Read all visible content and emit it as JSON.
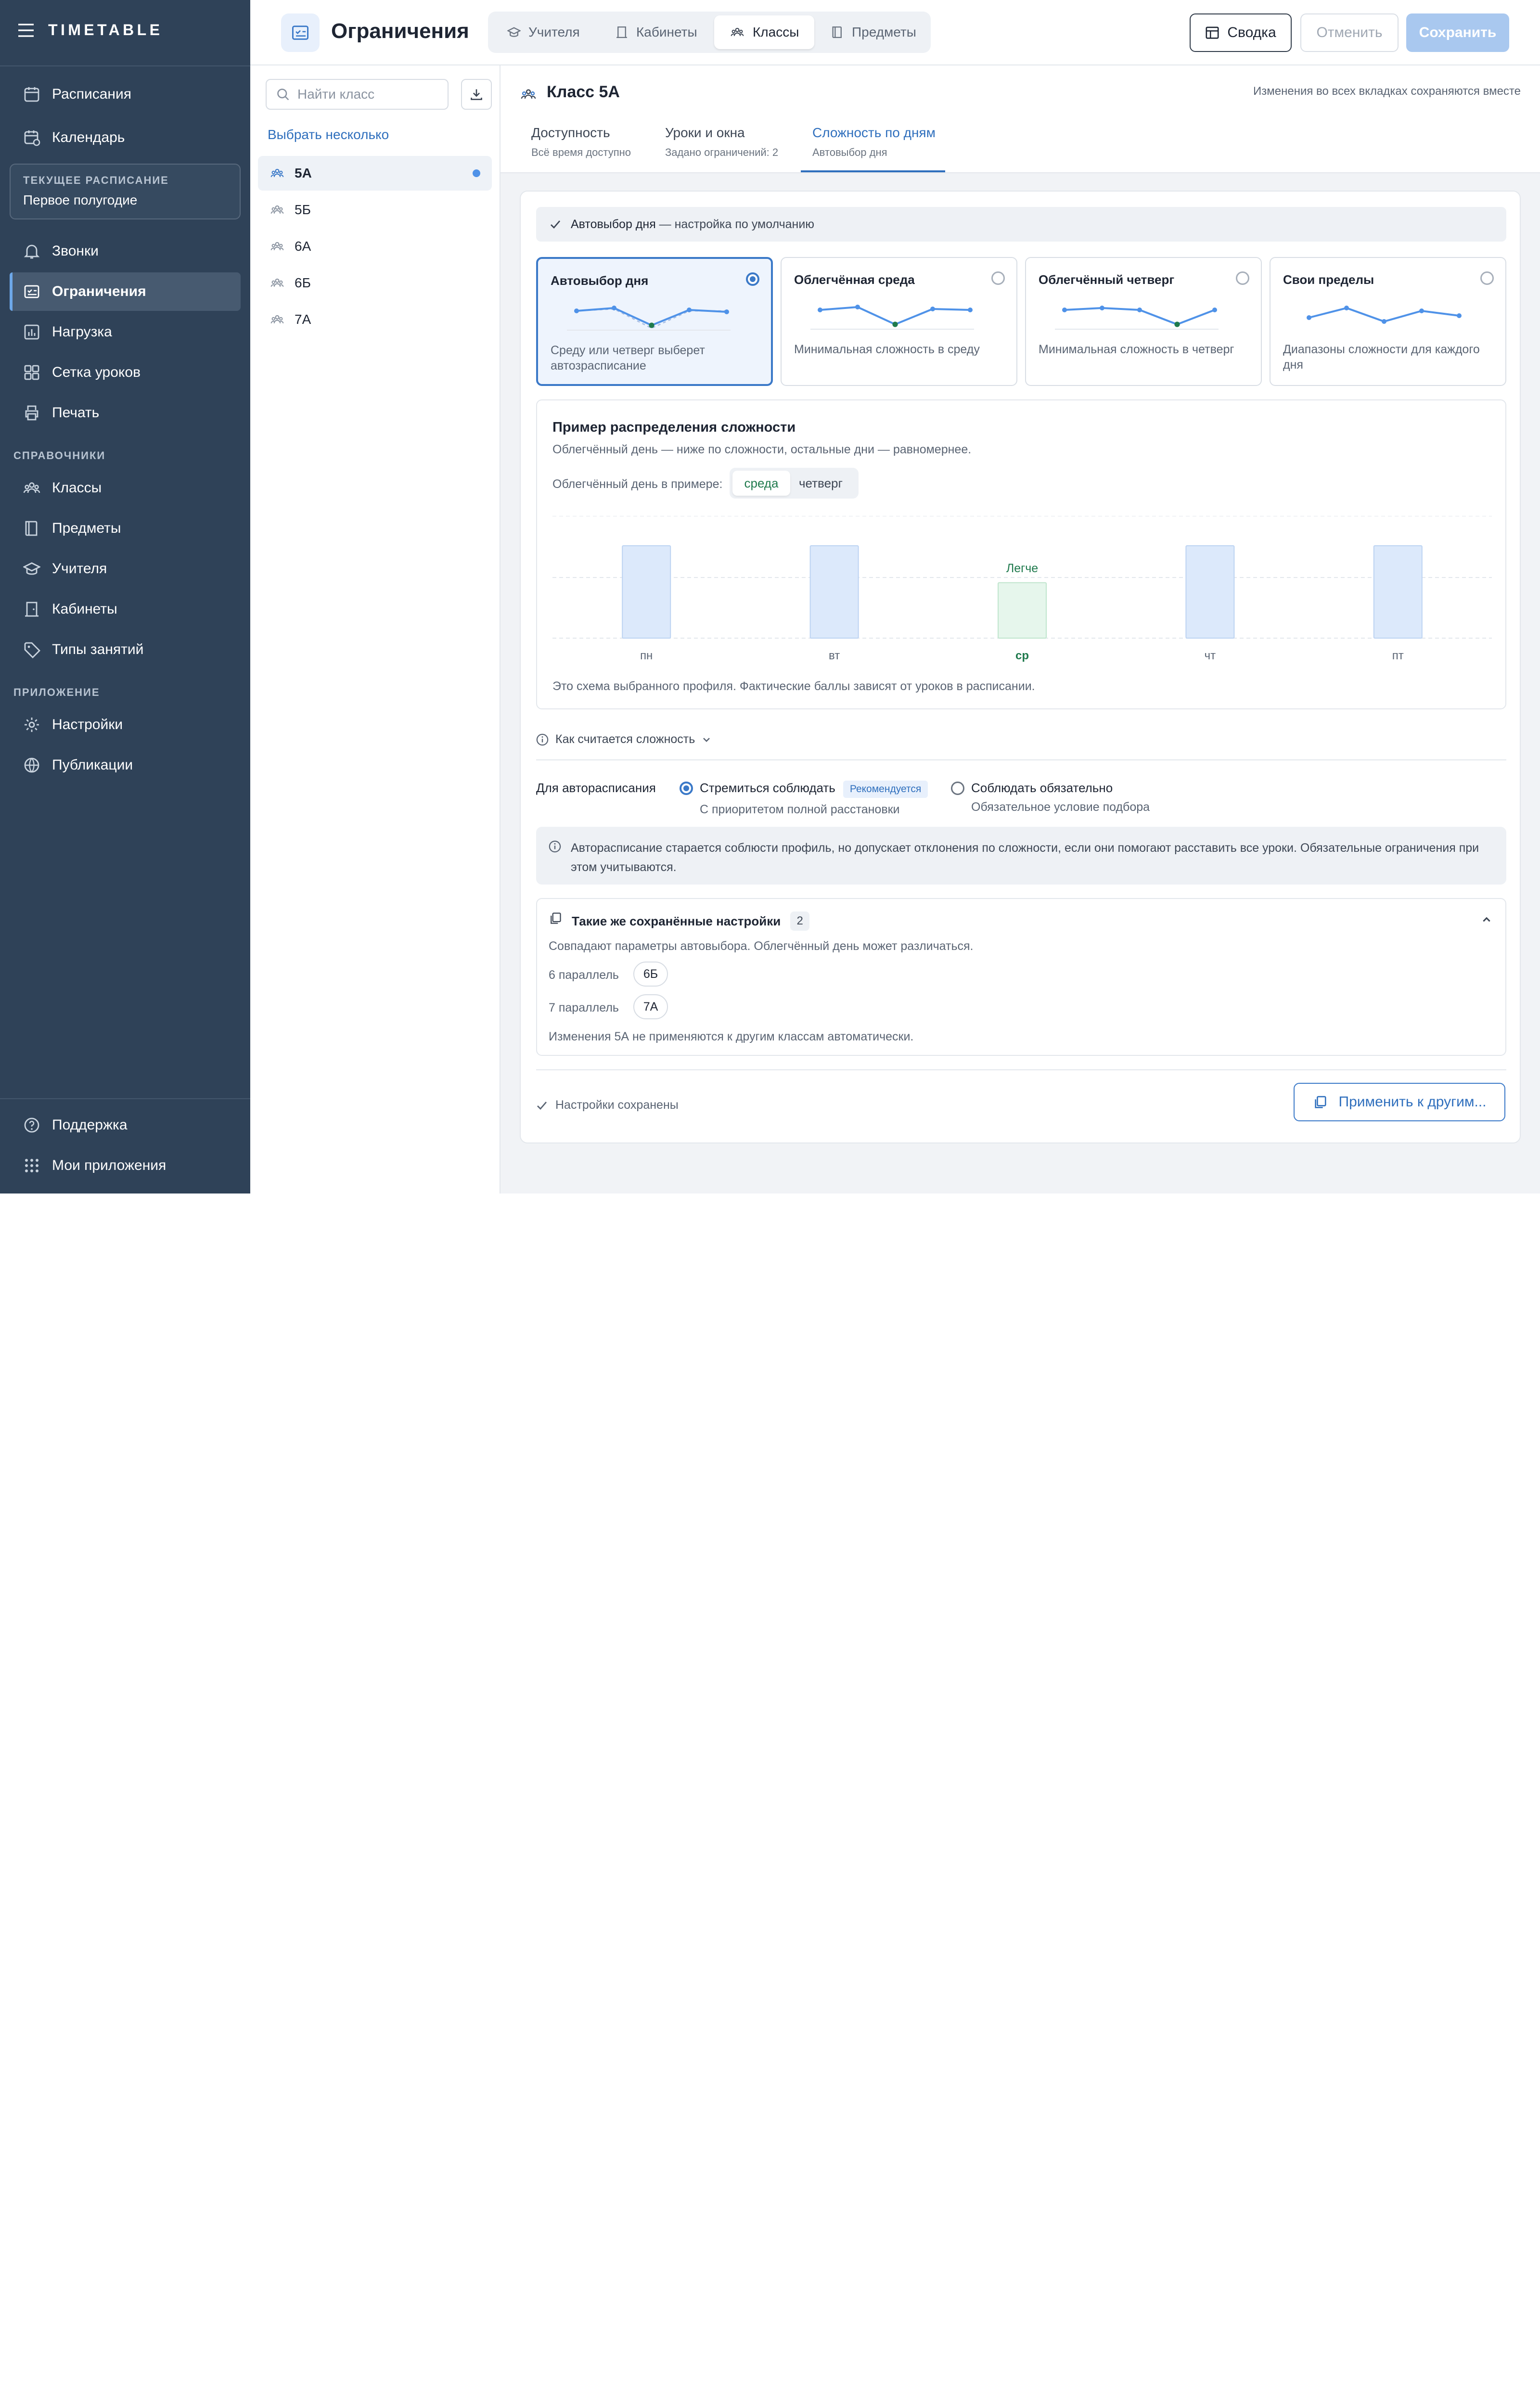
{
  "app": {
    "brand": "TIMETABLE"
  },
  "sidebar": {
    "top": [
      {
        "label": "Расписания",
        "icon": "calendar-icon"
      },
      {
        "label": "Календарь",
        "icon": "calendar-clock-icon"
      }
    ],
    "current": {
      "label": "ТЕКУЩЕЕ РАСПИСАНИЕ",
      "value": "Первое полугодие"
    },
    "main": [
      {
        "label": "Звонки",
        "icon": "bell-icon"
      },
      {
        "label": "Ограничения",
        "icon": "constraints-icon",
        "active": true
      },
      {
        "label": "Нагрузка",
        "icon": "load-chart-icon"
      },
      {
        "label": "Сетка уроков",
        "icon": "grid-icon"
      },
      {
        "label": "Печать",
        "icon": "printer-icon"
      }
    ],
    "ref_title": "СПРАВОЧНИКИ",
    "refs": [
      {
        "label": "Классы",
        "icon": "people-icon"
      },
      {
        "label": "Предметы",
        "icon": "book-icon"
      },
      {
        "label": "Учителя",
        "icon": "graduation-cap-icon"
      },
      {
        "label": "Кабинеты",
        "icon": "door-icon"
      },
      {
        "label": "Типы занятий",
        "icon": "tag-icon"
      }
    ],
    "app_title": "ПРИЛОЖЕНИЕ",
    "app": [
      {
        "label": "Настройки",
        "icon": "gear-icon"
      },
      {
        "label": "Публикации",
        "icon": "globe-icon"
      }
    ],
    "bottom": [
      {
        "label": "Поддержка",
        "icon": "help-icon"
      },
      {
        "label": "Мои приложения",
        "icon": "apps-grid-icon"
      }
    ]
  },
  "header": {
    "title": "Ограничения",
    "tabs": [
      {
        "label": "Учителя",
        "icon": "graduation-cap-icon"
      },
      {
        "label": "Кабинеты",
        "icon": "door-icon"
      },
      {
        "label": "Классы",
        "icon": "people-icon",
        "active": true
      },
      {
        "label": "Предметы",
        "icon": "book-icon"
      }
    ],
    "summary": "Сводка",
    "cancel": "Отменить",
    "save": "Сохранить"
  },
  "list": {
    "placeholder": "Найти класс",
    "multi": "Выбрать несколько",
    "items": [
      "5А",
      "5Б",
      "6А",
      "6Б",
      "7А"
    ],
    "selected": "5А"
  },
  "main": {
    "title": "Класс 5А",
    "note": "Изменения во всех вкладках сохраняются вместе",
    "tabs": [
      {
        "label": "Доступность",
        "sub": "Всё время доступно"
      },
      {
        "label": "Уроки и окна",
        "sub": "Задано ограничений: 2"
      },
      {
        "label": "Сложность по дням",
        "sub": "Автовыбор дня",
        "active": true
      }
    ],
    "banner": {
      "strong": "Автовыбор дня",
      "rest": " — настройка по умолчанию"
    },
    "options": [
      {
        "title": "Автовыбор дня",
        "desc": "Среду или четверг выберет автозрасписание",
        "active": true
      },
      {
        "title": "Облегчённая среда",
        "desc": "Минимальная сложность в среду"
      },
      {
        "title": "Облегчённый четверг",
        "desc": "Минимальная сложность в четверг"
      },
      {
        "title": "Свои пределы",
        "desc": "Диапазоны сложности для каждого дня"
      }
    ],
    "example": {
      "title": "Пример распределения сложности",
      "subtitle": "Облегчённый день — ниже по сложности, остальные дни — равномернее.",
      "light_label": "Облегчённый день в примере:",
      "light_options": [
        "среда",
        "четверг"
      ],
      "light_selected": "среда",
      "footnote": "Это схема выбранного профиля. Фактические баллы зависят от уроков в расписании."
    },
    "how": "Как считается сложность",
    "auto": {
      "label": "Для авторасписания",
      "opt1": {
        "label": "Стремиться соблюдать",
        "badge": "Рекомендуется",
        "sub": "С приоритетом полной расстановки",
        "checked": true
      },
      "opt2": {
        "label": "Соблюдать обязательно",
        "sub": "Обязательное условие подбора"
      }
    },
    "info": "Авторасписание старается соблюсти профиль, но допускает отклонения по сложности, если они помогают расставить все уроки. Обязательные ограничения при этом учитываются.",
    "same": {
      "title": "Такие же сохранённые настройки",
      "count": "2",
      "desc": "Совпадают параметры автовыбора. Облегчённый день может различаться.",
      "groups": [
        {
          "label": "6 параллель",
          "chip": "6Б"
        },
        {
          "label": "7 параллель",
          "chip": "7А"
        }
      ],
      "note": "Изменения 5А не применяются к другим классам автоматически."
    },
    "saved": "Настройки сохранены",
    "apply": "Применить к другим..."
  },
  "chart_data": {
    "type": "bar",
    "categories": [
      "пн",
      "вт",
      "ср",
      "чт",
      "пт"
    ],
    "values": [
      1,
      1,
      0.6,
      1,
      1
    ],
    "highlight": "ср",
    "highlight_label": "Легче",
    "colors": {
      "normal": "#dce9fb",
      "light": "#e6f6ec"
    }
  }
}
